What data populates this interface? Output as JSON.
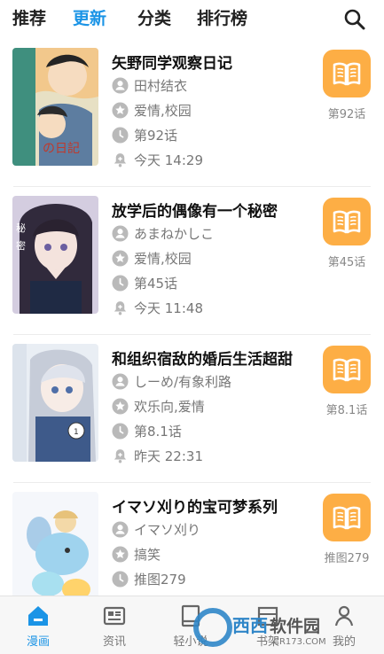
{
  "topnav": {
    "tabs": [
      {
        "label": "推荐",
        "active": false
      },
      {
        "label": "更新",
        "active": true
      },
      {
        "label": "分类",
        "active": false
      },
      {
        "label": "排行榜",
        "active": false
      }
    ],
    "search_icon": "search-icon",
    "accent_color": "#1b94e6"
  },
  "items": [
    {
      "title": "矢野同学观察日记",
      "author": "田村结衣",
      "tags": "爱情,校园",
      "chapter": "第92话",
      "updated": "今天 14:29",
      "read_label": "第92话"
    },
    {
      "title": "放学后的偶像有一个秘密",
      "author": "あまねかしこ",
      "tags": "爱情,校园",
      "chapter": "第45话",
      "updated": "今天 11:48",
      "read_label": "第45话"
    },
    {
      "title": "和组织宿敌的婚后生活超甜",
      "author": "しーめ/有象利路",
      "tags": "欢乐向,爱情",
      "chapter": "第8.1话",
      "updated": "昨天 22:31",
      "read_label": "第8.1话"
    },
    {
      "title": "イマソ刈り的宝可梦系列",
      "author": "イマソ刈り",
      "tags": "搞笑",
      "chapter": "推图279",
      "updated": "",
      "read_label": "推图279"
    }
  ],
  "bottom_tabs": [
    {
      "label": "漫画",
      "icon": "home-icon",
      "active": true
    },
    {
      "label": "资讯",
      "icon": "news-icon",
      "active": false
    },
    {
      "label": "轻小说",
      "icon": "book-icon",
      "active": false
    },
    {
      "label": "书架",
      "icon": "shelf-icon",
      "active": false
    },
    {
      "label": "我的",
      "icon": "user-icon",
      "active": false
    }
  ],
  "watermark": {
    "brand": "西西软件园",
    "domain": "CR173.COM"
  },
  "colors": {
    "read_button": "#fdae45",
    "meta_icon": "#b9b9b9"
  }
}
